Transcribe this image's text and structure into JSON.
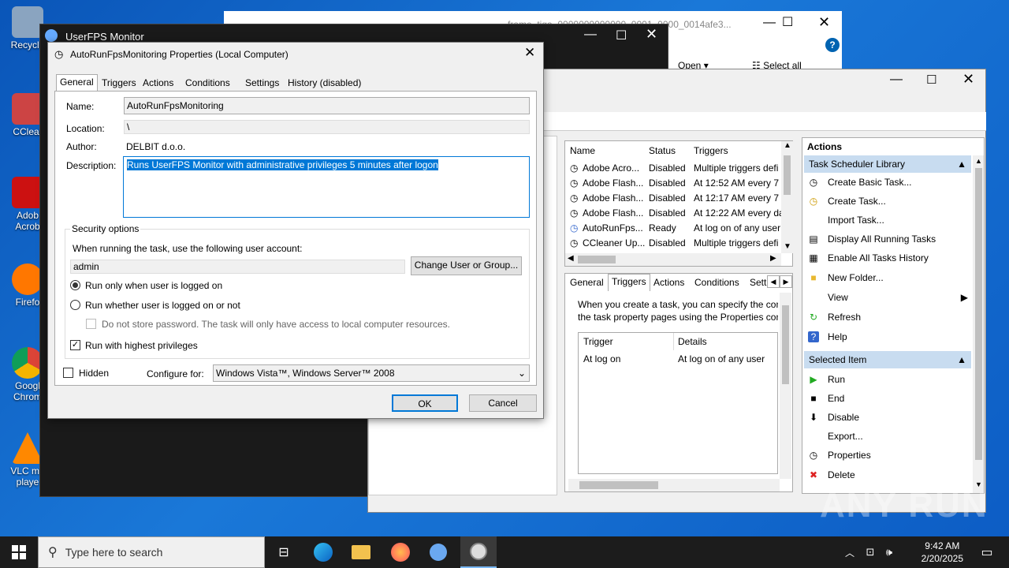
{
  "desktop": {
    "icons": [
      {
        "label": "Recycle",
        "color": "#9ab"
      },
      {
        "label": "CClear",
        "color": "#c44"
      },
      {
        "label": "Adob Acrob",
        "color": "#c11"
      },
      {
        "label": "Firefo",
        "color": "#f70"
      },
      {
        "label": "Googl Chrom",
        "color": "#3a7"
      },
      {
        "label": "VLC me playe",
        "color": "#f80"
      }
    ]
  },
  "userfps": {
    "title": "UserFPS Monitor"
  },
  "explorer": {
    "tab_title": "frame_tiga_0000000000000_0001_0000_0014afe3...",
    "open_label": "Open",
    "select_all_label": "Select all"
  },
  "scheduler": {
    "task_list": {
      "columns": [
        "Name",
        "Status",
        "Triggers"
      ],
      "rows": [
        {
          "name": "Adobe Acro...",
          "status": "Disabled",
          "triggers": "Multiple triggers defi"
        },
        {
          "name": "Adobe Flash...",
          "status": "Disabled",
          "triggers": "At 12:52 AM every 7 c"
        },
        {
          "name": "Adobe Flash...",
          "status": "Disabled",
          "triggers": "At 12:17 AM every 7 c"
        },
        {
          "name": "Adobe Flash...",
          "status": "Disabled",
          "triggers": "At 12:22 AM every da"
        },
        {
          "name": "AutoRunFps...",
          "status": "Ready",
          "triggers": "At log on of any user"
        },
        {
          "name": "CCleaner Up...",
          "status": "Disabled",
          "triggers": "Multiple triggers defi"
        }
      ]
    },
    "detail_tabs": [
      "General",
      "Triggers",
      "Actions",
      "Conditions",
      "Setti"
    ],
    "detail_text_1": "When you create a task, you can specify the con",
    "detail_text_2": "the task property pages using the Properties con",
    "trigger_table": {
      "columns": [
        "Trigger",
        "Details"
      ],
      "rows": [
        {
          "trigger": "At log on",
          "details": "At log on of any user"
        }
      ]
    },
    "actions": {
      "header": "Actions",
      "section1": "Task Scheduler Library",
      "items1": [
        {
          "label": "Create Basic Task...",
          "icon": "create-basic-task-icon"
        },
        {
          "label": "Create Task...",
          "icon": "create-task-icon"
        },
        {
          "label": "Import Task...",
          "icon": ""
        },
        {
          "label": "Display All Running Tasks",
          "icon": "running-tasks-icon"
        },
        {
          "label": "Enable All Tasks History",
          "icon": "history-icon"
        },
        {
          "label": "New Folder...",
          "icon": "folder-icon"
        },
        {
          "label": "View",
          "icon": ""
        },
        {
          "label": "Refresh",
          "icon": "refresh-icon"
        },
        {
          "label": "Help",
          "icon": "help-icon"
        }
      ],
      "section2": "Selected Item",
      "items2": [
        {
          "label": "Run",
          "icon": "run-icon"
        },
        {
          "label": "End",
          "icon": "end-icon"
        },
        {
          "label": "Disable",
          "icon": "disable-icon"
        },
        {
          "label": "Export...",
          "icon": ""
        },
        {
          "label": "Properties",
          "icon": "properties-icon"
        },
        {
          "label": "Delete",
          "icon": "delete-icon"
        }
      ]
    }
  },
  "dialog": {
    "title": "AutoRunFpsMonitoring Properties (Local Computer)",
    "tabs": [
      "General",
      "Triggers",
      "Actions",
      "Conditions",
      "Settings",
      "History (disabled)"
    ],
    "name_label": "Name:",
    "name_value": "AutoRunFpsMonitoring",
    "location_label": "Location:",
    "location_value": "\\",
    "author_label": "Author:",
    "author_value": "DELBIT d.o.o.",
    "description_label": "Description:",
    "description_value": "Runs UserFPS Monitor with administrative privileges 5 minutes after logon",
    "security_title": "Security options",
    "user_account_label": "When running the task, use the following user account:",
    "user_account_value": "admin",
    "change_user_button": "Change User or Group...",
    "radio_logged_on": "Run only when user is logged on",
    "radio_whether": "Run whether user is logged on or not",
    "no_store_password": "Do not store password.  The task will only have access to local computer resources.",
    "highest_privileges": "Run with highest privileges",
    "hidden_label": "Hidden",
    "configure_label": "Configure for:",
    "configure_value": "Windows Vista™, Windows Server™ 2008",
    "ok_button": "OK",
    "cancel_button": "Cancel"
  },
  "taskbar": {
    "search_placeholder": "Type here to search",
    "time": "9:42 AM",
    "date": "2/20/2025"
  },
  "watermark": "ANY RUN"
}
